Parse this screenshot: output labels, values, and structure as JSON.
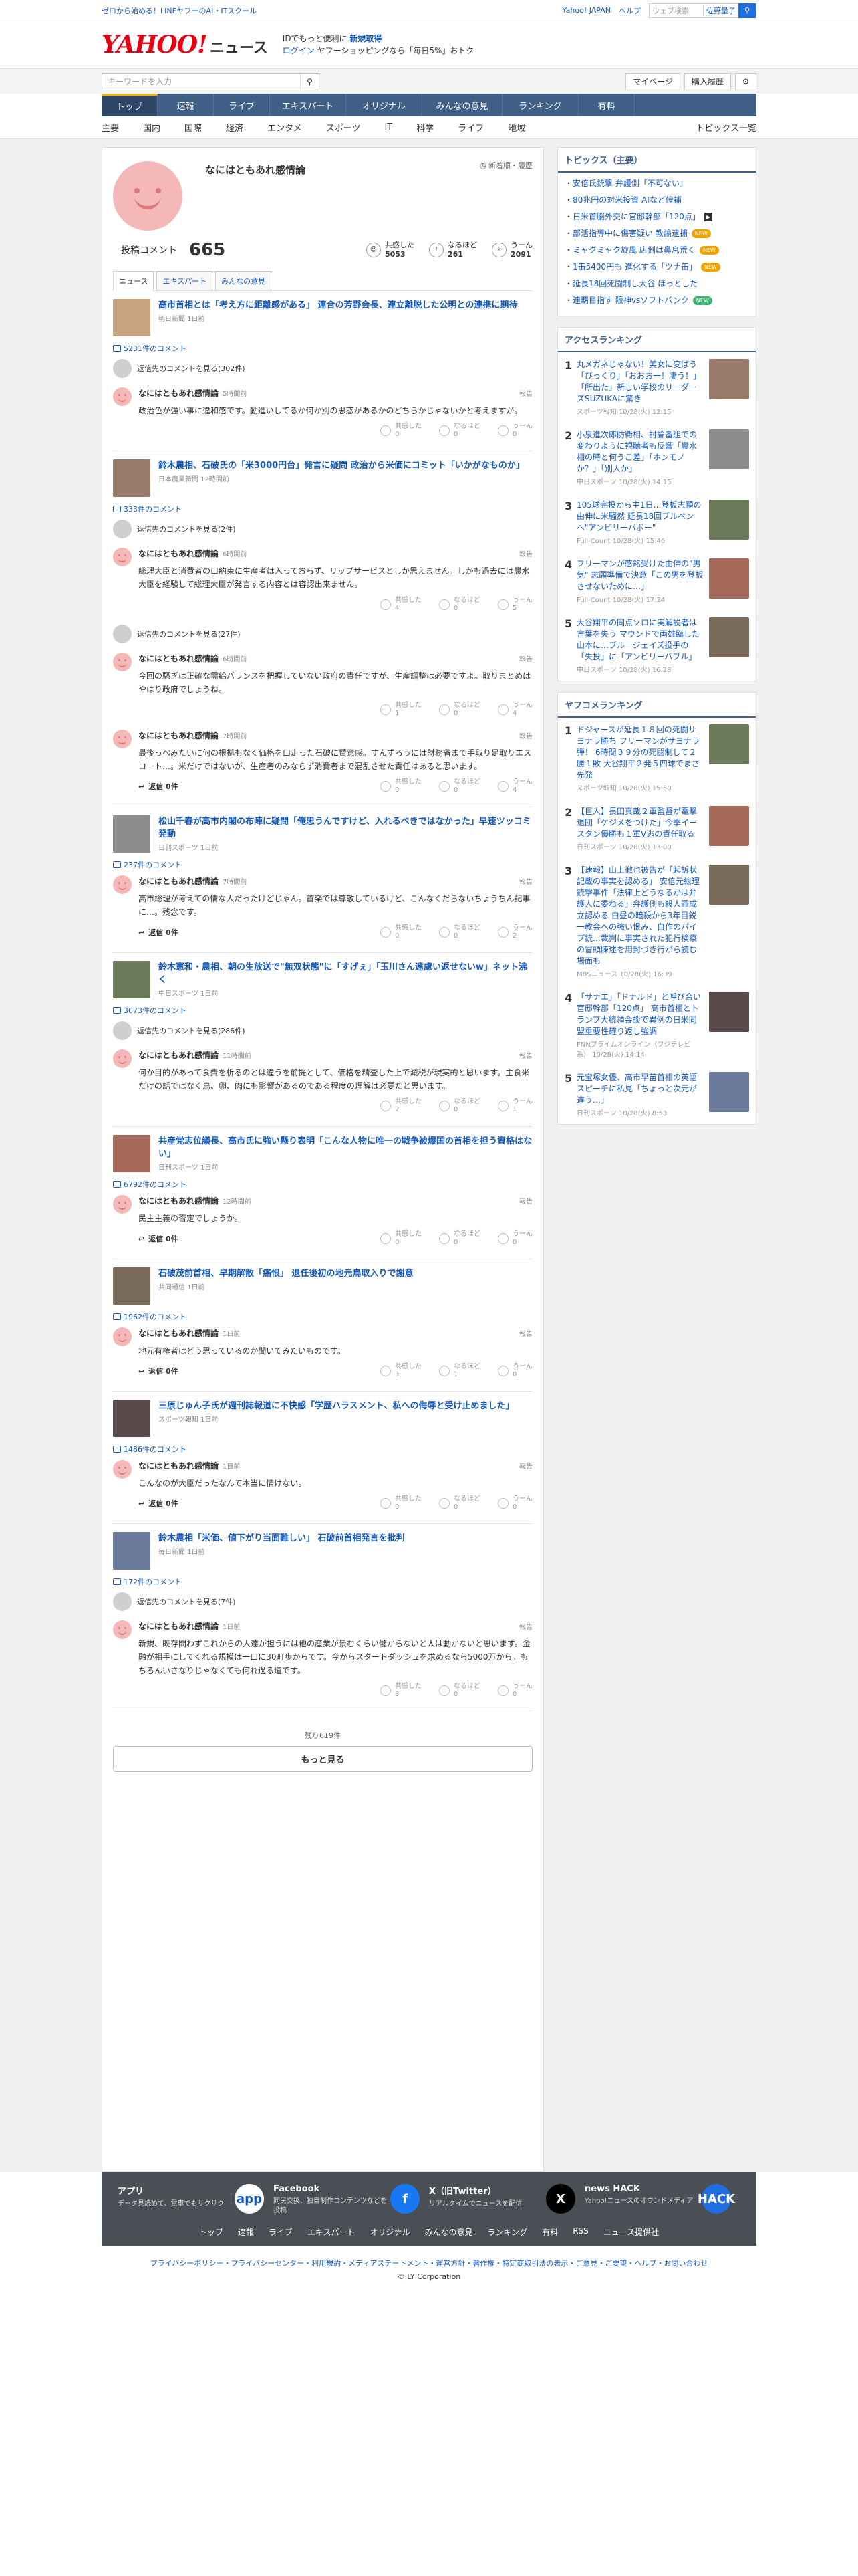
{
  "topbar": {
    "promo": "ゼロから始める！LINEヤフーのAI・ITスクール",
    "links": [
      "Yahoo! JAPAN",
      "ヘルプ"
    ],
    "search_placeholder": "ウェブ検索",
    "search_select": "佐野量子"
  },
  "header": {
    "logo": "YAHOO!",
    "logo_sub": "ニュース",
    "logo_jp": "JAPAN",
    "msg1a": "IDでもっと便利に",
    "msg1b": "新規取得",
    "msg2a": "ログイン",
    "msg2b": "ヤフーショッピングなら「毎日5%」おトク"
  },
  "search": {
    "placeholder": "キーワードを入力",
    "mypage": "マイページ",
    "history": "購入履歴"
  },
  "nav": [
    "トップ",
    "速報",
    "ライブ",
    "エキスパート",
    "オリジナル",
    "みんなの意見",
    "ランキング",
    "有料"
  ],
  "subnav": [
    "主要",
    "国内",
    "国際",
    "経済",
    "エンタメ",
    "スポーツ",
    "IT",
    "科学",
    "ライフ",
    "地域"
  ],
  "subnav_right": "トピックス一覧",
  "profile": {
    "name": "なにはともあれ感情論",
    "meta": "新着順・履歴",
    "posts_label": "投稿コメント",
    "posts": "665",
    "stats": [
      {
        "label": "共感した",
        "value": "5053"
      },
      {
        "label": "なるほど",
        "value": "261"
      },
      {
        "label": "うーん",
        "value": "2091"
      }
    ]
  },
  "tabs": [
    "ニュース",
    "エキスパート",
    "みんなの意見"
  ],
  "articles": [
    {
      "title": "高市首相とは「考え方に距離感がある」 連合の芳野会長、連立離脱した公明との連携に期待",
      "source": "朝日新聞 1日前",
      "comments": "5231件のコメント",
      "more": "返信先のコメントを見る(302件)",
      "cmt": [
        {
          "time": "5時間前",
          "text": "政治色が強い事に違和感です。勤進いしてるか何か別の思惑があるかのどちらかじゃないかと考えますが。",
          "v": [
            "0",
            "0",
            "0"
          ]
        }
      ]
    },
    {
      "title": "鈴木農相、石破氏の「米3000円台」発言に疑問 政治から米価にコミット「いかがなものか」",
      "source": "日本農業新聞 12時間前",
      "comments": "333件のコメント",
      "more": "返信先のコメントを見る(2件)",
      "cmt": [
        {
          "time": "6時間前",
          "text": "総理大臣と消費者の口約束に生産者は入っておらず、リップサービスとしか思えません。しかも過去には農水大臣を経験して総理大臣が発言する内容とは容認出来ません。",
          "v": [
            "4",
            "0",
            "5"
          ]
        }
      ],
      "more2": "返信先のコメントを見る(27件)",
      "cmt2": [
        {
          "time": "6時間前",
          "text": "今回の騒ぎは正確な需給バランスを把握していない政府の責任ですが、生産調整は必要ですよ。取りまとめはやはり政府でしょうね。",
          "v": [
            "1",
            "0",
            "4"
          ]
        },
        {
          "time": "7時間前",
          "text": "最後っぺみたいに何の根拠もなく価格を口走った石破に賛意感。すんずろうには財務省まで手取り足取りエスコート…。米だけではないが、生産者のみならず消費者まで混乱させた責任はあると思います。",
          "v": [
            "0",
            "0",
            "4"
          ]
        }
      ]
    },
    {
      "title": "松山千春が高市内閣の布陣に疑問「俺思うんですけど、入れるべきではなかった」早速ツッコミ発動",
      "source": "日刊スポーツ 1日前",
      "comments": "237件のコメント",
      "cmt": [
        {
          "time": "7時間前",
          "text": "高市総理が考えての情な人だったけどじゃん。首楽では尊敬しているけど、こんなくだらないちょうちん記事に…。残念です。",
          "v": [
            "0",
            "0",
            "2"
          ]
        }
      ]
    },
    {
      "title": "鈴木憲和・農相、朝の生放送で\"無双状態\"に「すげぇ」「玉川さん遠慮い返せないw」ネット沸く",
      "source": "中日スポーツ 1日前",
      "comments": "3673件のコメント",
      "more": "返信先のコメントを見る(286件)",
      "cmt": [
        {
          "time": "11時間前",
          "text": "何か目的があって食費を析るのとは違うを前提として、価格を精査した上で減税が現実的と思います。主食米だけの話ではなく鳥、卵、肉にも影響があるのである程度の理解は必要だと思います。",
          "v": [
            "2",
            "0",
            "1"
          ]
        }
      ]
    },
    {
      "title": "共産党志位議長、高市氏に強い懸り表明「こんな人物に唯一の戦争被爆国の首相を担う資格はない」",
      "source": "日刊スポーツ 1日前",
      "comments": "6792件のコメント",
      "cmt": [
        {
          "time": "12時間前",
          "text": "民主主義の否定でしょうか。",
          "v": [
            "0",
            "0",
            "0"
          ]
        }
      ]
    },
    {
      "title": "石破茂前首相、早期解散「痛恨」 退任後初の地元鳥取入りで謝意",
      "source": "共同通信 1日前",
      "comments": "1962件のコメント",
      "cmt": [
        {
          "time": "1日前",
          "text": "地元有権者はどう思っているのか聞いてみたいものです。",
          "v": [
            "3",
            "1",
            "0"
          ]
        }
      ]
    },
    {
      "title": "三原じゅん子氏が週刊誌報道に不快感「学歴ハラスメント、私への侮辱と受け止めました」",
      "source": "スポーツ報知 1日前",
      "comments": "1486件のコメント",
      "cmt": [
        {
          "time": "1日前",
          "text": "こんなのが大臣だったなんて本当に情けない。",
          "v": [
            "0",
            "0",
            "0"
          ]
        }
      ]
    },
    {
      "title": "鈴木農相「米価、値下がり当面難しい」 石破前首相発言を批判",
      "source": "毎日新聞 1日前",
      "comments": "172件のコメント",
      "more": "返信先のコメントを見る(7件)",
      "cmt": [
        {
          "time": "1日前",
          "text": "新規、既存問わずこれからの人達が担うには他の産業が景むくらい儲からないと人は動かないと思います。金融が相手にしてくれる規模は一口に30町歩からです。今からスタートダッシュを求めるなら5000万から。もちろんいさなりじゃなくても何れ過る道です。",
          "v": [
            "8",
            "0",
            "0"
          ]
        }
      ]
    }
  ],
  "labels": {
    "report": "報告",
    "reply": "返信 0件",
    "v1": "共感した",
    "v2": "なるほど",
    "v3": "うーん"
  },
  "remaining": "残り619件",
  "more_btn": "もっと見る",
  "topics_head": "トピックス（主要）",
  "topics": [
    {
      "t": "安倍氏銃撃 弁護側「不可ない」",
      "b": ""
    },
    {
      "t": "80兆円の対米投資 AIなど候補",
      "b": ""
    },
    {
      "t": "日米首脳外交に官邸幹部「120点」",
      "b": "sq"
    },
    {
      "t": "部活指導中に傷害疑い 教諭逮捕",
      "b": "new"
    },
    {
      "t": "ミャクミャク旋風 店側は鼻息荒く",
      "b": "new"
    },
    {
      "t": "1缶5400円も 進化する「ツナ缶」",
      "b": "new"
    },
    {
      "t": "延長18回死闘制し大谷 ほっとした",
      "b": ""
    },
    {
      "t": "連覇目指す 阪神vsソフトバンク",
      "b": "g"
    }
  ],
  "access_head": "アクセスランキング",
  "access": [
    {
      "t": "丸メガネじゃない！美女に変ばう「びっくり」「おおお一！凄う！」「所出た」新しい学校のリーダーズSUZUKAに驚き",
      "s": "スポーツ報知 10/28(火) 12:15"
    },
    {
      "t": "小泉進次郎防衛相、討論番組での変わりように視聴者も反響「農水相の時と何うこ差」「ホンモノか？」「別人か」",
      "s": "中日スポーツ 10/28(火) 14:15"
    },
    {
      "t": "105球完投から中1日…登板志願の由伸に米騒然 延長18回ブルペンへ\"アンビリーバボー\"",
      "s": "Full-Count 10/28(火) 15:46"
    },
    {
      "t": "フリーマンが感銘受けた由伸の\"男気\" 志願準備で決意「この男を登板させないために…」",
      "s": "Full-Count 10/28(火) 17:24"
    },
    {
      "t": "大谷翔平の同点ソロに実解説者は言葉を失う マウンドで両雄臨した山本に…ブルージェイズ投手の「失投」に「アンビリーバブル」",
      "s": "中日スポーツ 10/28(火) 16:28"
    }
  ],
  "yahoo_head": "ヤフコメランキング",
  "yahoo": [
    {
      "t": "ドジャースが延長１８回の死闘サヨナラ勝ち フリーマンがサヨナラ弾！ 6時間３９分の死闘制して２勝１敗 大谷翔平２発５四球でまさ先発",
      "s": "スポーツ報知 10/28(火) 15:50"
    },
    {
      "t": "【巨人】長田真哉２軍監督が電撃退団「ケジメをつけた」今季イースタン優勝も１軍V逃の責任取る",
      "s": "日刊スポーツ 10/28(火) 13:00"
    },
    {
      "t": "【速報】山上徹也被告が「起訴状記載の事実を認める」 安倍元総理銃撃事件「法律上どうなるかは弁護人に委ねる」弁護側も殺人罪成立認める 白昼の暗殺から3年目鋭一教会への強い恨み、自作のパイプ銃…裁判に事実された犯行検察の冒頭陳述を用封づき行がら読む場面も",
      "s": "MBSニュース 10/28(火) 16:39"
    },
    {
      "t": "「サナエ」「ドナルド」と呼び合い 官邸幹部「120点」 高市首相とトランプ大統領会談で異例の日米同盟重要性確り返し強調",
      "s": "FNNプライムオンライン（フジテレビ系） 10/28(火) 14:14"
    },
    {
      "t": "元宝塚女優、高市早苗首相の英語スピーチに私見「ちょっと次元が違う…」",
      "s": "日刊スポーツ 10/28(火) 8:53"
    }
  ],
  "footer": {
    "apps": [
      {
        "t": "アプリ",
        "d": "データ見読めて、電車でもサクサク",
        "i": "app"
      },
      {
        "t": "Facebook",
        "d": "同民交換、独自制作コンテンツなどを投稿",
        "i": "f"
      },
      {
        "t": "X（旧Twitter）",
        "d": "リアルタイムでニュースを配信",
        "i": "X"
      },
      {
        "t": "news HACK",
        "d": "Yahoo!ニュースのオウンドメディア",
        "i": "HACK"
      }
    ],
    "links": [
      "トップ",
      "速報",
      "ライブ",
      "エキスパート",
      "オリジナル",
      "みんなの意見",
      "ランキング",
      "有料",
      "RSS",
      "ニュース提供社"
    ],
    "legal": "プライバシーポリシー・プライバシーセンター・利用規約・メディアステートメント・運営方針・著作権・特定商取引法の表示・ご意見・ご要望・ヘルプ・お問い合わせ",
    "copyright": "© LY Corporation"
  },
  "colors": {
    "accent": "#3f5f86",
    "link": "#1458b8",
    "brand": "#e60012"
  }
}
